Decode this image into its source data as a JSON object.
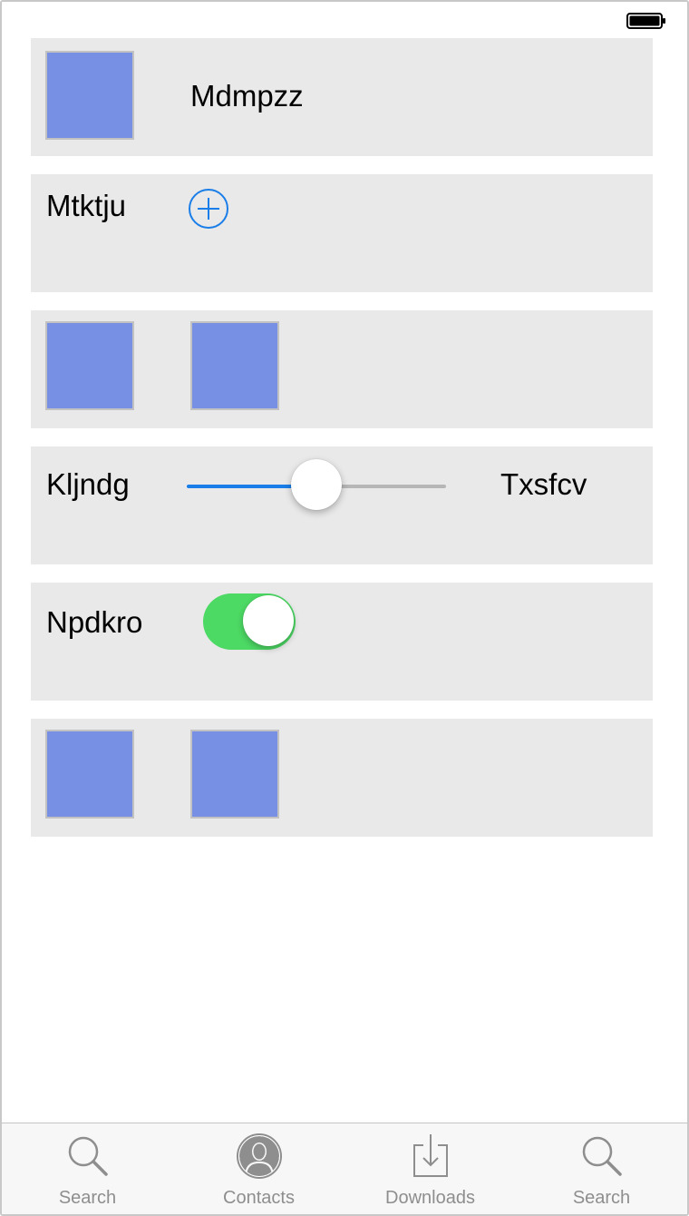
{
  "status_bar": {
    "battery_icon": "battery-full-icon",
    "battery_level": 1.0
  },
  "rows": [
    {
      "kind": "image-text",
      "label": "Mdmpzz"
    },
    {
      "kind": "label-button",
      "label": "Mtktju",
      "button_icon": "add-circle-icon"
    },
    {
      "kind": "images",
      "image_count": 2
    },
    {
      "kind": "slider",
      "label_left": "Kljndg",
      "label_right": "Txsfcv",
      "value": 0.5
    },
    {
      "kind": "switch",
      "label": "Npdkro",
      "on": true
    },
    {
      "kind": "images",
      "image_count": 2
    }
  ],
  "tabbar": {
    "tabs": [
      {
        "label": "Search",
        "icon": "search-icon"
      },
      {
        "label": "Contacts",
        "icon": "contacts-icon"
      },
      {
        "label": "Downloads",
        "icon": "downloads-icon"
      },
      {
        "label": "Search",
        "icon": "search-icon"
      }
    ]
  },
  "colors": {
    "row_background": "#e9e9e9",
    "image_placeholder": "#7890e3",
    "tint_blue": "#1a7ee8",
    "switch_on": "#4cd964",
    "tab_inactive": "#8e8e8e"
  }
}
